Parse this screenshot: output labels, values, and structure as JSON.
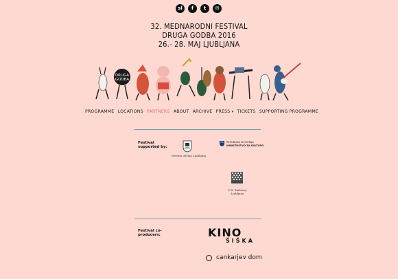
{
  "social": [
    {
      "label": "sl",
      "name": "language-sl-icon"
    },
    {
      "label": "f",
      "name": "facebook-icon"
    },
    {
      "label": "t",
      "name": "twitter-icon"
    },
    {
      "label": "✉",
      "name": "mail-icon"
    }
  ],
  "header": {
    "line1": "32. MEDNARODNI FESTIVAL",
    "line2": "DRUGA GODBA 2016",
    "line3": "26.- 28. MAJ LJUBLJANA",
    "logo_text_1": "DRUGA",
    "logo_text_2": "GODBA"
  },
  "nav": {
    "items": [
      "PROGRAMME",
      "LOCATIONS",
      "PARTNERS",
      "ABOUT",
      "ARCHIVE",
      "PRESS",
      "TICKETS",
      "SUPPORTING PROGRAMME"
    ],
    "active": "PARTNERS",
    "press_caret": "▾"
  },
  "supported": {
    "label": "Festival supported by:",
    "mol": "Mestna občina Ljubljana",
    "ministry_1": "REPUBLIKA SLOVENIJA",
    "ministry_2": "MINISTRSTVO ZA KULTURO",
    "embassy_1": "U.S. Embassy",
    "embassy_2": "Ljubljana"
  },
  "coproducers": {
    "label": "Festival co-producers:",
    "kino_1": "KINO",
    "kino_2": "ŠIŠKA",
    "cankarjev": "cankarjev dom"
  },
  "colors": {
    "background": "#fdd9d2",
    "active_nav": "#e86b80",
    "rule": "#7d9ba8"
  }
}
